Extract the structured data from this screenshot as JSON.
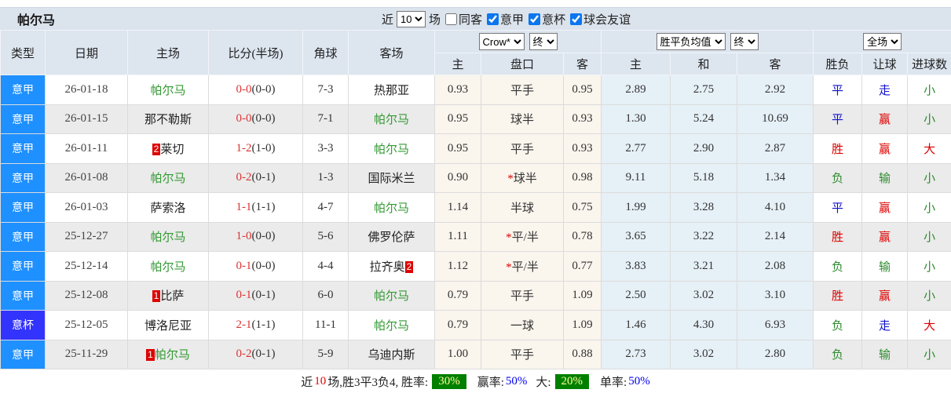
{
  "title": "帕尔马",
  "filter_bar": {
    "recent_label": "近",
    "recent_value": "10",
    "matches_label": "场",
    "checkboxes": [
      {
        "label": "同客",
        "checked": false
      },
      {
        "label": "意甲",
        "checked": true
      },
      {
        "label": "意杯",
        "checked": true
      },
      {
        "label": "球会友谊",
        "checked": true
      }
    ]
  },
  "table": {
    "left_headers": [
      "类型",
      "日期",
      "主场",
      "比分(半场)",
      "角球",
      "客场"
    ],
    "odds_group": {
      "select1": "Crow*",
      "select2": "终",
      "sub": [
        "主",
        "盘口",
        "客"
      ]
    },
    "avg_group": {
      "select1": "胜平负均值",
      "select2": "终",
      "sub": [
        "主",
        "和",
        "客"
      ]
    },
    "result_group": {
      "select1": "全场",
      "sub": [
        "胜负",
        "让球",
        "进球数"
      ]
    },
    "rows": [
      {
        "type": "意甲",
        "typeClass": "league",
        "date": "26-01-18",
        "home": {
          "name": "帕尔马",
          "green": true,
          "badge": null,
          "badgePos": "before"
        },
        "score": "0-0",
        "half": "(0-0)",
        "corners": "7-3",
        "away": {
          "name": "热那亚",
          "green": false,
          "badge": null,
          "badgePos": "before"
        },
        "odds": {
          "home": "0.93",
          "line": "平手",
          "star": false,
          "away": "0.95"
        },
        "avg": {
          "home": "2.89",
          "draw": "2.75",
          "away": "2.92"
        },
        "outcome": {
          "wl": {
            "t": "平",
            "c": "b"
          },
          "handicap": {
            "t": "走",
            "c": "b"
          },
          "goals": {
            "t": "小",
            "c": "g"
          }
        }
      },
      {
        "type": "意甲",
        "typeClass": "league",
        "date": "26-01-15",
        "home": {
          "name": "那不勒斯",
          "green": false,
          "badge": null,
          "badgePos": "before"
        },
        "score": "0-0",
        "half": "(0-0)",
        "corners": "7-1",
        "away": {
          "name": "帕尔马",
          "green": true,
          "badge": null,
          "badgePos": "before"
        },
        "odds": {
          "home": "0.95",
          "line": "球半",
          "star": false,
          "away": "0.93"
        },
        "avg": {
          "home": "1.30",
          "draw": "5.24",
          "away": "10.69"
        },
        "outcome": {
          "wl": {
            "t": "平",
            "c": "b"
          },
          "handicap": {
            "t": "赢",
            "c": "r"
          },
          "goals": {
            "t": "小",
            "c": "g"
          }
        }
      },
      {
        "type": "意甲",
        "typeClass": "league",
        "date": "26-01-11",
        "home": {
          "name": "莱切",
          "green": false,
          "badge": "2",
          "badgePos": "before"
        },
        "score": "1-2",
        "half": "(1-0)",
        "corners": "3-3",
        "away": {
          "name": "帕尔马",
          "green": true,
          "badge": null,
          "badgePos": "before"
        },
        "odds": {
          "home": "0.95",
          "line": "平手",
          "star": false,
          "away": "0.93"
        },
        "avg": {
          "home": "2.77",
          "draw": "2.90",
          "away": "2.87"
        },
        "outcome": {
          "wl": {
            "t": "胜",
            "c": "r"
          },
          "handicap": {
            "t": "赢",
            "c": "r"
          },
          "goals": {
            "t": "大",
            "c": "r"
          }
        }
      },
      {
        "type": "意甲",
        "typeClass": "league",
        "date": "26-01-08",
        "home": {
          "name": "帕尔马",
          "green": true,
          "badge": null,
          "badgePos": "before"
        },
        "score": "0-2",
        "half": "(0-1)",
        "corners": "1-3",
        "away": {
          "name": "国际米兰",
          "green": false,
          "badge": null,
          "badgePos": "before"
        },
        "odds": {
          "home": "0.90",
          "line": "球半",
          "star": true,
          "away": "0.98"
        },
        "avg": {
          "home": "9.11",
          "draw": "5.18",
          "away": "1.34"
        },
        "outcome": {
          "wl": {
            "t": "负",
            "c": "g"
          },
          "handicap": {
            "t": "输",
            "c": "g"
          },
          "goals": {
            "t": "小",
            "c": "g"
          }
        }
      },
      {
        "type": "意甲",
        "typeClass": "league",
        "date": "26-01-03",
        "home": {
          "name": "萨索洛",
          "green": false,
          "badge": null,
          "badgePos": "before"
        },
        "score": "1-1",
        "half": "(1-1)",
        "corners": "4-7",
        "away": {
          "name": "帕尔马",
          "green": true,
          "badge": null,
          "badgePos": "before"
        },
        "odds": {
          "home": "1.14",
          "line": "半球",
          "star": false,
          "away": "0.75"
        },
        "avg": {
          "home": "1.99",
          "draw": "3.28",
          "away": "4.10"
        },
        "outcome": {
          "wl": {
            "t": "平",
            "c": "b"
          },
          "handicap": {
            "t": "赢",
            "c": "r"
          },
          "goals": {
            "t": "小",
            "c": "g"
          }
        }
      },
      {
        "type": "意甲",
        "typeClass": "league",
        "date": "25-12-27",
        "home": {
          "name": "帕尔马",
          "green": true,
          "badge": null,
          "badgePos": "before"
        },
        "score": "1-0",
        "half": "(0-0)",
        "corners": "5-6",
        "away": {
          "name": "佛罗伦萨",
          "green": false,
          "badge": null,
          "badgePos": "before"
        },
        "odds": {
          "home": "1.11",
          "line": "平/半",
          "star": true,
          "away": "0.78"
        },
        "avg": {
          "home": "3.65",
          "draw": "3.22",
          "away": "2.14"
        },
        "outcome": {
          "wl": {
            "t": "胜",
            "c": "r"
          },
          "handicap": {
            "t": "赢",
            "c": "r"
          },
          "goals": {
            "t": "小",
            "c": "g"
          }
        }
      },
      {
        "type": "意甲",
        "typeClass": "league",
        "date": "25-12-14",
        "home": {
          "name": "帕尔马",
          "green": true,
          "badge": null,
          "badgePos": "before"
        },
        "score": "0-1",
        "half": "(0-0)",
        "corners": "4-4",
        "away": {
          "name": "拉齐奥",
          "green": false,
          "badge": "2",
          "badgePos": "after"
        },
        "odds": {
          "home": "1.12",
          "line": "平/半",
          "star": true,
          "away": "0.77"
        },
        "avg": {
          "home": "3.83",
          "draw": "3.21",
          "away": "2.08"
        },
        "outcome": {
          "wl": {
            "t": "负",
            "c": "g"
          },
          "handicap": {
            "t": "输",
            "c": "g"
          },
          "goals": {
            "t": "小",
            "c": "g"
          }
        }
      },
      {
        "type": "意甲",
        "typeClass": "league",
        "date": "25-12-08",
        "home": {
          "name": "比萨",
          "green": false,
          "badge": "1",
          "badgePos": "before"
        },
        "score": "0-1",
        "half": "(0-1)",
        "corners": "6-0",
        "away": {
          "name": "帕尔马",
          "green": true,
          "badge": null,
          "badgePos": "before"
        },
        "odds": {
          "home": "0.79",
          "line": "平手",
          "star": false,
          "away": "1.09"
        },
        "avg": {
          "home": "2.50",
          "draw": "3.02",
          "away": "3.10"
        },
        "outcome": {
          "wl": {
            "t": "胜",
            "c": "r"
          },
          "handicap": {
            "t": "赢",
            "c": "r"
          },
          "goals": {
            "t": "小",
            "c": "g"
          }
        }
      },
      {
        "type": "意杯",
        "typeClass": "cup",
        "date": "25-12-05",
        "home": {
          "name": "博洛尼亚",
          "green": false,
          "badge": null,
          "badgePos": "before"
        },
        "score": "2-1",
        "half": "(1-1)",
        "corners": "11-1",
        "away": {
          "name": "帕尔马",
          "green": true,
          "badge": null,
          "badgePos": "before"
        },
        "odds": {
          "home": "0.79",
          "line": "一球",
          "star": false,
          "away": "1.09"
        },
        "avg": {
          "home": "1.46",
          "draw": "4.30",
          "away": "6.93"
        },
        "outcome": {
          "wl": {
            "t": "负",
            "c": "g"
          },
          "handicap": {
            "t": "走",
            "c": "b"
          },
          "goals": {
            "t": "大",
            "c": "r"
          }
        }
      },
      {
        "type": "意甲",
        "typeClass": "league",
        "date": "25-11-29",
        "home": {
          "name": "帕尔马",
          "green": true,
          "badge": "1",
          "badgePos": "before"
        },
        "score": "0-2",
        "half": "(0-1)",
        "corners": "5-9",
        "away": {
          "name": "乌迪内斯",
          "green": false,
          "badge": null,
          "badgePos": "before"
        },
        "odds": {
          "home": "1.00",
          "line": "平手",
          "star": false,
          "away": "0.88"
        },
        "avg": {
          "home": "2.73",
          "draw": "3.02",
          "away": "2.80"
        },
        "outcome": {
          "wl": {
            "t": "负",
            "c": "g"
          },
          "handicap": {
            "t": "输",
            "c": "g"
          },
          "goals": {
            "t": "小",
            "c": "g"
          }
        }
      }
    ]
  },
  "summary": {
    "seg1": "近",
    "recent_count": "10",
    "seg2": "场,胜3平3负4, 胜率:",
    "win_rate": "30%",
    "seg3": "赢率:",
    "handicap_win_rate": "50%",
    "seg4": "大:",
    "big_rate": "20%",
    "seg5": "单率:",
    "odd_rate": "50%"
  },
  "colors": {
    "league_badge": "#1e90ff",
    "cup_badge": "#3333fe",
    "win_red": "#dd0000",
    "draw_blue": "#1111cc",
    "lose_green": "#2e8b2e",
    "team_highlight_green": "#339933",
    "score_red": "#dd3333",
    "odds_col_bg": "#faf5ed",
    "avg_col_bg": "#e6f0f7",
    "header_bg": "#dde5ef",
    "rate_badge_bg": "#008000",
    "rate_badge_text": "#ffff99",
    "rate_blue": "#0000ee"
  }
}
